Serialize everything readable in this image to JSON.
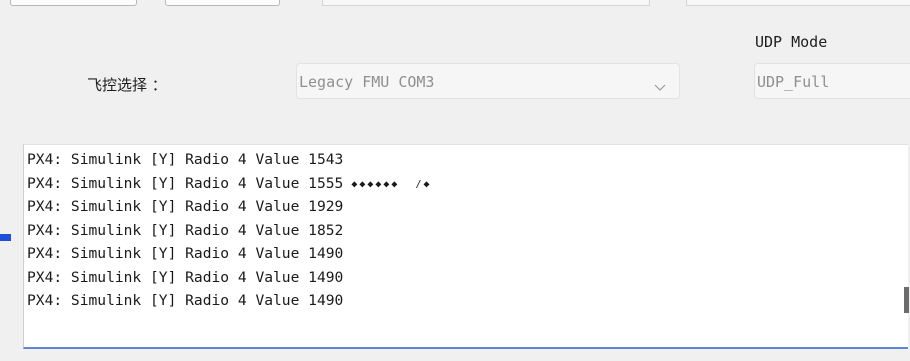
{
  "flight_control": {
    "label": "飞控选择 ：",
    "selected": "Legacy FMU COM3"
  },
  "udp_mode": {
    "label": "UDP Mode",
    "selected": "UDP_Full"
  },
  "log": {
    "lines": [
      {
        "text": "PX4: Simulink [Y] Radio 4 Value 1543",
        "suffix": ""
      },
      {
        "text": "PX4: Simulink [Y] Radio 4 Value 1555",
        "suffix": " ◆◆◆◆◆◆  /◆"
      },
      {
        "text": "PX4: Simulink [Y] Radio 4 Value 1929",
        "suffix": ""
      },
      {
        "text": "PX4: Simulink [Y] Radio 4 Value 1852",
        "suffix": ""
      },
      {
        "text": "PX4: Simulink [Y] Radio 4 Value 1490",
        "suffix": ""
      },
      {
        "text": "PX4: Simulink [Y] Radio 4 Value 1490",
        "suffix": ""
      },
      {
        "text": "PX4: Simulink [Y] Radio 4 Value 1490",
        "suffix": ""
      }
    ]
  },
  "colors": {
    "accent": "#1f4fd6",
    "log_border": "#5a87d8",
    "scroll_thumb": "#6b6b6b"
  }
}
